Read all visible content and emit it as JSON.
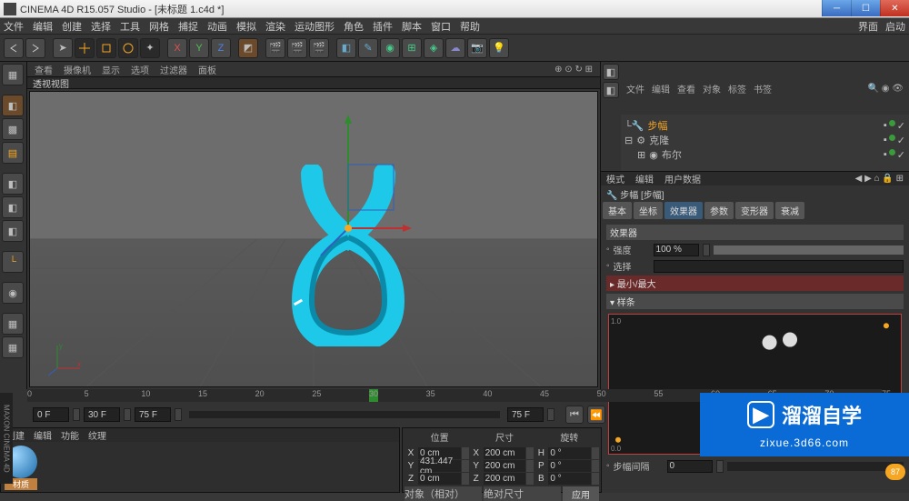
{
  "window": {
    "title": "CINEMA 4D R15.057 Studio - [未标题 1.c4d *]"
  },
  "menu": {
    "items": [
      "文件",
      "编辑",
      "创建",
      "选择",
      "工具",
      "网格",
      "捕捉",
      "动画",
      "模拟",
      "渲染",
      "运动图形",
      "角色",
      "插件",
      "脚本",
      "窗口",
      "帮助"
    ],
    "right": [
      "界面",
      "启动"
    ]
  },
  "viewport": {
    "menu": [
      "查看",
      "摄像机",
      "显示",
      "选项",
      "过滤器",
      "面板"
    ],
    "title": "透视视图"
  },
  "objects": {
    "tabs": [
      "文件",
      "编辑",
      "查看",
      "对象",
      "标签",
      "书签"
    ],
    "items": [
      {
        "name": "步幅",
        "selected": true
      },
      {
        "name": "克隆",
        "selected": false
      },
      {
        "name": "布尔",
        "selected": false
      }
    ]
  },
  "attr": {
    "hdr": [
      "模式",
      "编辑",
      "用户数据"
    ],
    "title": "步幅 [步幅]",
    "tabs": [
      "基本",
      "坐标",
      "效果器",
      "参数",
      "变形器",
      "衰减"
    ],
    "activeTab": 2,
    "section1": "效果器",
    "strengthLabel": "强度",
    "strengthVal": "100 %",
    "selLabel": "选择",
    "section2": "最小/最大",
    "gapLabel": "步幅间隔",
    "gapVal": "0"
  },
  "timeline": {
    "marks": [
      "0",
      "5",
      "10",
      "15",
      "20",
      "25",
      "30",
      "35",
      "40",
      "45",
      "50",
      "55",
      "60",
      "65",
      "70",
      "75"
    ],
    "playhead": 30,
    "startF": "0 F",
    "curF": "30 F",
    "endF1": "75 F",
    "endF2": "75 F"
  },
  "material": {
    "menu": [
      "创建",
      "编辑",
      "功能",
      "纹理"
    ],
    "label": "材质"
  },
  "coord": {
    "hdr": [
      "位置",
      "尺寸",
      "旋转"
    ],
    "rows": [
      {
        "a": "X",
        "av": "0 cm",
        "b": "X",
        "bv": "200 cm",
        "c": "H",
        "cv": "0 °"
      },
      {
        "a": "Y",
        "av": "431.447 cm",
        "b": "Y",
        "bv": "200 cm",
        "c": "P",
        "cv": "0 °"
      },
      {
        "a": "Z",
        "av": "0 cm",
        "b": "Z",
        "bv": "200 cm",
        "c": "B",
        "cv": "0 °"
      }
    ],
    "mode1": "对象（相对）",
    "mode2": "绝对尺寸",
    "apply": "应用"
  },
  "watermark": {
    "brand": "溜溜自学",
    "url": "zixue.3d66.com"
  },
  "badge": "87"
}
